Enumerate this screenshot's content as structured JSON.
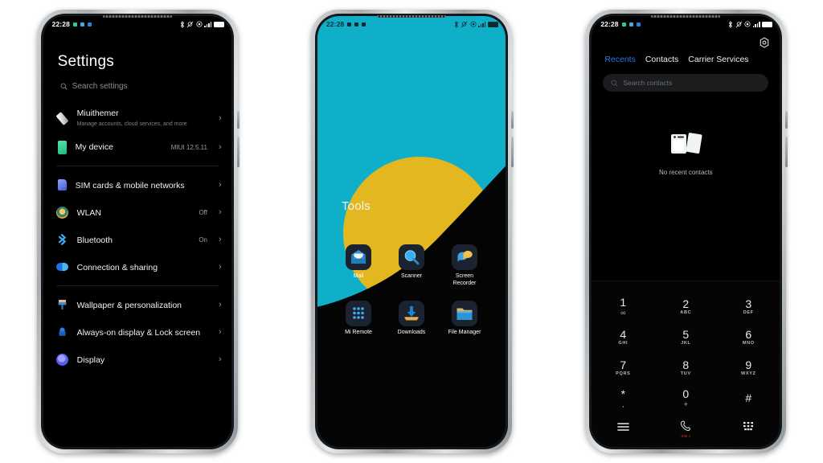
{
  "meta": {
    "colors": {
      "home_bg_cyan": "#10AFC9",
      "sun_yellow": "#E3B71F",
      "hill_black": "#040404",
      "tab_active_blue": "#2B74E0",
      "screen_black": "#000000",
      "frame_silver": "#c6cacd"
    }
  },
  "statusbar": {
    "time": "22:28",
    "notification_dots": [
      "#2ecc8f",
      "#4aa8d8",
      "#2f7fe0"
    ],
    "icons": [
      "bluetooth-icon",
      "location-off-icon",
      "dnd-icon",
      "signal-bars-icon",
      "battery-icon"
    ]
  },
  "phone1_settings": {
    "title": "Settings",
    "search": {
      "placeholder": "Search settings",
      "icon": "search-icon"
    },
    "groups": [
      {
        "items": [
          {
            "name": "Miuithemer",
            "subtitle": "Manage accounts, cloud services, and more",
            "value": "",
            "icon": "account-icon",
            "icon_color": "#e8e9ea"
          },
          {
            "name": "My device",
            "subtitle": "",
            "value": "MIUI 12.5.11",
            "icon": "device-icon",
            "icon_color": "#3ddc97"
          }
        ]
      },
      {
        "items": [
          {
            "name": "SIM cards & mobile networks",
            "subtitle": "",
            "value": "",
            "icon": "sim-card-icon",
            "icon_color": "#5b74e8"
          },
          {
            "name": "WLAN",
            "subtitle": "",
            "value": "Off",
            "icon": "wifi-icon",
            "icon_color": "#d8a54a"
          },
          {
            "name": "Bluetooth",
            "subtitle": "",
            "value": "On",
            "icon": "bluetooth-icon",
            "icon_color": "#3fa9f5"
          },
          {
            "name": "Connection & sharing",
            "subtitle": "",
            "value": "",
            "icon": "connection-sharing-icon",
            "icon_color": "#2f80ed"
          }
        ]
      },
      {
        "items": [
          {
            "name": "Wallpaper & personalization",
            "subtitle": "",
            "value": "",
            "icon": "paintbrush-icon",
            "icon_color": "#4a90d9"
          },
          {
            "name": "Always-on display & Lock screen",
            "subtitle": "",
            "value": "",
            "icon": "lock-screen-icon",
            "icon_color": "#2a6fd6"
          },
          {
            "name": "Display",
            "subtitle": "",
            "value": "",
            "icon": "display-icon",
            "icon_color": "#6d6ef0"
          }
        ]
      }
    ],
    "chevron": "›"
  },
  "phone2_home": {
    "folder_title": "Tools",
    "apps": [
      {
        "label": "Mail",
        "icon": "mail-icon"
      },
      {
        "label": "Scanner",
        "icon": "scanner-icon"
      },
      {
        "label": "Screen Recorder",
        "icon": "screen-recorder-icon"
      },
      {
        "label": "Mi Remote",
        "icon": "mi-remote-icon"
      },
      {
        "label": "Downloads",
        "icon": "downloads-icon"
      },
      {
        "label": "File Manager",
        "icon": "file-manager-icon"
      }
    ]
  },
  "phone3_dialer": {
    "settings_icon": "gear-icon",
    "tabs": [
      {
        "label": "Recents",
        "active": true
      },
      {
        "label": "Contacts",
        "active": false
      },
      {
        "label": "Carrier Services",
        "active": false
      }
    ],
    "search": {
      "placeholder": "Search contacts",
      "icon": "search-icon"
    },
    "empty_state": {
      "label": "No recent contacts",
      "icon": "empty-contacts-icon"
    },
    "keypad": [
      {
        "num": "1",
        "sub": "∞",
        "sub_is_symbol": true
      },
      {
        "num": "2",
        "sub": "ABC",
        "sub_is_symbol": false
      },
      {
        "num": "3",
        "sub": "DEF",
        "sub_is_symbol": false
      },
      {
        "num": "4",
        "sub": "GHI",
        "sub_is_symbol": false
      },
      {
        "num": "5",
        "sub": "JKL",
        "sub_is_symbol": false
      },
      {
        "num": "6",
        "sub": "MNO",
        "sub_is_symbol": false
      },
      {
        "num": "7",
        "sub": "PQRS",
        "sub_is_symbol": false
      },
      {
        "num": "8",
        "sub": "TUV",
        "sub_is_symbol": false
      },
      {
        "num": "9",
        "sub": "WXYZ",
        "sub_is_symbol": false
      },
      {
        "num": "*",
        "sub": ",",
        "sub_is_symbol": true
      },
      {
        "num": "0",
        "sub": "+",
        "sub_is_symbol": true
      },
      {
        "num": "#",
        "sub": "",
        "sub_is_symbol": true
      }
    ],
    "navbar": [
      {
        "icon": "menu-icon",
        "label": ""
      },
      {
        "icon": "call-icon",
        "label": "SIM 1"
      },
      {
        "icon": "keypad-icon",
        "label": ""
      }
    ]
  }
}
